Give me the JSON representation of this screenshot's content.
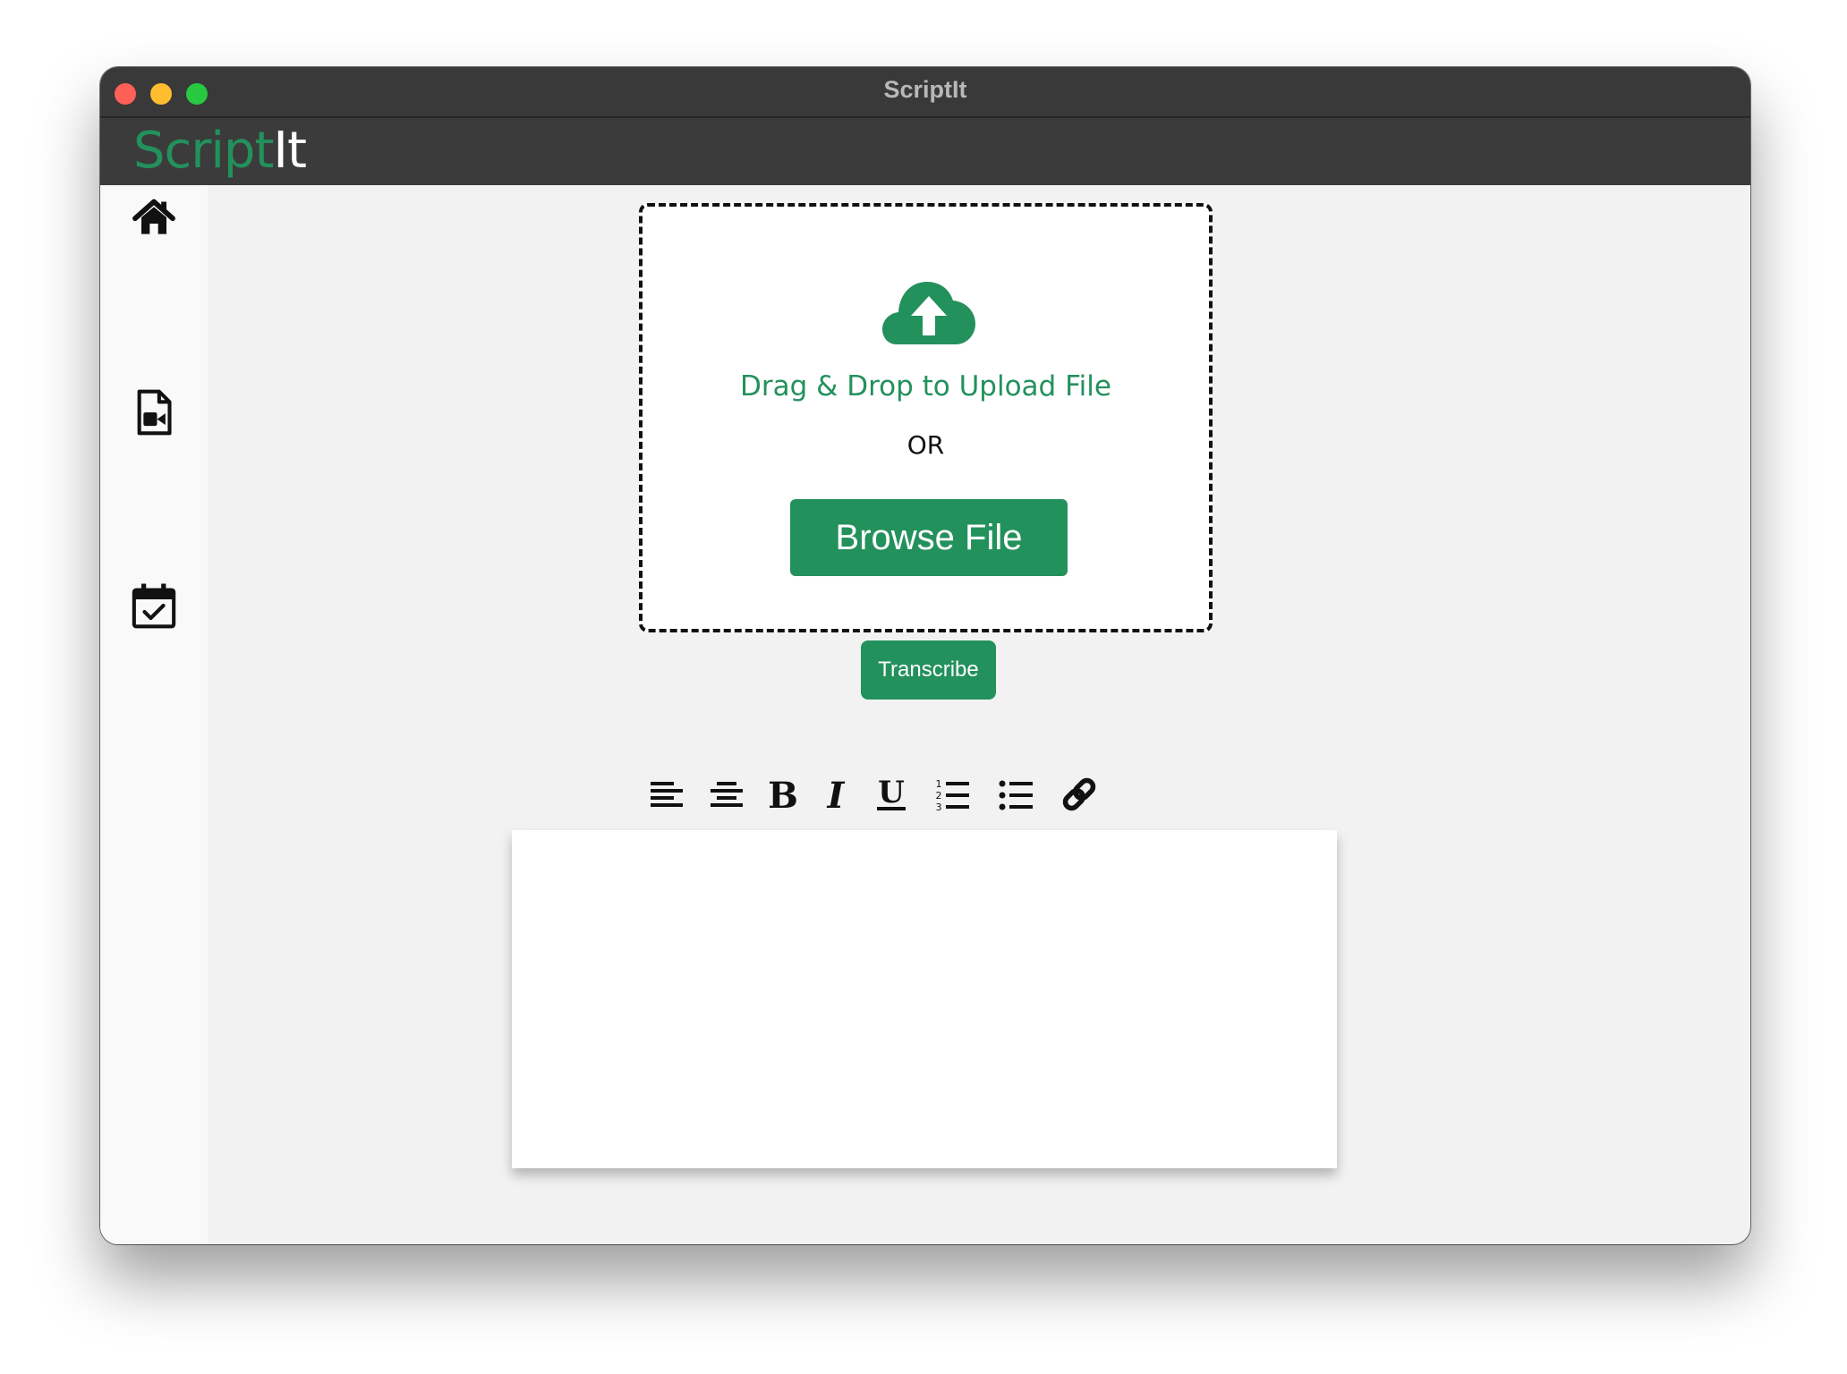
{
  "window": {
    "title": "ScriptIt"
  },
  "app": {
    "logo_part1": "Script",
    "logo_part2": "It"
  },
  "sidebar": {
    "items": [
      {
        "icon": "home-icon"
      },
      {
        "icon": "video-file-icon"
      },
      {
        "icon": "calendar-check-icon"
      }
    ]
  },
  "upload": {
    "icon": "cloud-upload-icon",
    "drag_text": "Drag & Drop to Upload File",
    "or_text": "OR",
    "browse_label": "Browse File"
  },
  "transcribe_label": "Transcribe",
  "editor_toolbar": {
    "tools": [
      "align-left-icon",
      "align-center-icon",
      "bold-icon",
      "italic-icon",
      "underline-icon",
      "ordered-list-icon",
      "bullet-list-icon",
      "link-icon"
    ]
  },
  "editor": {
    "content": ""
  },
  "colors": {
    "accent": "#23915c",
    "titlebar": "#393939",
    "appbar": "#3b3b3b",
    "background": "#f2f2f2"
  }
}
